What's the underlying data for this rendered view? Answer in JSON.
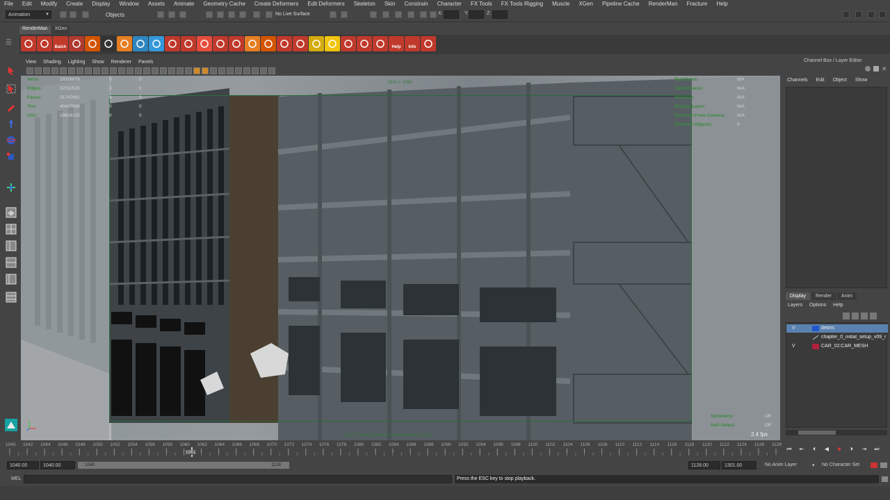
{
  "menubar": [
    "File",
    "Edit",
    "Modify",
    "Create",
    "Display",
    "Window",
    "Assets",
    "Animate",
    "Geometry Cache",
    "Create Deformers",
    "Edit Deformers",
    "Skeleton",
    "Skin",
    "Constrain",
    "Character",
    "FX Tools",
    "FX Tools Rigging",
    "Muscle",
    "XGen",
    "Pipeline Cache",
    "RenderMan",
    "Fracture",
    "Help"
  ],
  "status": {
    "mode": "Animation",
    "objects_label": "Objects",
    "no_live_surface": "No Live Surface",
    "x_label": "X:",
    "y_label": "Y:",
    "z_label": "Z:"
  },
  "shelf": {
    "tabs": [
      "RenderMan",
      "XGen"
    ],
    "icons": [
      {
        "name": "render-settings-icon",
        "label": "",
        "color": "#c0392b"
      },
      {
        "name": "render-preview-icon",
        "label": "",
        "color": "#c0392b"
      },
      {
        "name": "render-batch-icon",
        "label": "Batch",
        "color": "#c0392b"
      },
      {
        "name": "render-region-icon",
        "label": "",
        "color": "#b03a2e"
      },
      {
        "name": "globe-wire-icon",
        "label": "",
        "color": "#d35400"
      },
      {
        "name": "eye-icon",
        "label": "",
        "color": "#333333"
      },
      {
        "name": "light-bulb-icon",
        "label": "",
        "color": "#e67e22"
      },
      {
        "name": "env-sphere-icon",
        "label": "",
        "color": "#2e86c1"
      },
      {
        "name": "blue-sphere-icon",
        "label": "",
        "color": "#3498db"
      },
      {
        "name": "shader-list-icon",
        "label": "",
        "color": "#c0392b"
      },
      {
        "name": "texture-icon",
        "label": "",
        "color": "#c0392b"
      },
      {
        "name": "pattern-icon",
        "label": "",
        "color": "#e74c3c"
      },
      {
        "name": "plane-light-icon",
        "label": "",
        "color": "#c0392b"
      },
      {
        "name": "brush-icon",
        "label": "",
        "color": "#c0392b"
      },
      {
        "name": "hand-icon",
        "label": "",
        "color": "#e67e22"
      },
      {
        "name": "globe-orange-icon",
        "label": "",
        "color": "#d35400"
      },
      {
        "name": "image-tool-icon",
        "label": "",
        "color": "#c0392b"
      },
      {
        "name": "search-doc-icon",
        "label": "",
        "color": "#c0392b"
      },
      {
        "name": "spotlight-icon",
        "label": "",
        "color": "#d4ac0d"
      },
      {
        "name": "yellow-sphere-icon",
        "label": "",
        "color": "#f1c40f"
      },
      {
        "name": "crosshair-icon",
        "label": "",
        "color": "#c0392b"
      },
      {
        "name": "curve-tool-icon",
        "label": "",
        "color": "#c0392b"
      },
      {
        "name": "graph-icon",
        "label": "",
        "color": "#c0392b"
      },
      {
        "name": "help-icon",
        "label": "Help",
        "color": "#c0392b"
      },
      {
        "name": "info-icon",
        "label": "Info",
        "color": "#c0392b"
      },
      {
        "name": "plugin-icon",
        "label": "",
        "color": "#c0392b"
      }
    ]
  },
  "panel": {
    "menu": [
      "View",
      "Shading",
      "Lighting",
      "Show",
      "Renderer",
      "Panels"
    ],
    "resolution": "1920 x 1080",
    "camera": "vn017_renderCamera (defaultRenderLayer)",
    "fps": "2.4 fps",
    "hud_left": [
      {
        "label": "Verts:",
        "value": "20326679",
        "a": "0",
        "b": "0"
      },
      {
        "label": "Edges:",
        "value": "52011529",
        "a": "0",
        "b": "0"
      },
      {
        "label": "Faces:",
        "value": "31747691",
        "a": "0",
        "b": "0"
      },
      {
        "label": "Tris:",
        "value": "40427939",
        "a": "0",
        "b": "0"
      },
      {
        "label": "UVs:",
        "value": "18626125",
        "a": "0",
        "b": "0"
      }
    ],
    "hud_right": [
      {
        "label": "Backfaces:",
        "value": "N/A"
      },
      {
        "label": "Smoothness:",
        "value": "N/A"
      },
      {
        "label": "Instance:",
        "value": "N/A"
      },
      {
        "label": "Display Layer:",
        "value": "N/A"
      },
      {
        "label": "Distance From Camera:",
        "value": "N/A"
      },
      {
        "label": "Selected Objects:",
        "value": "0"
      }
    ],
    "hud_bottom": [
      {
        "label": "Symmetry:",
        "value": "Off"
      },
      {
        "label": "Soft Select:",
        "value": "Off"
      }
    ]
  },
  "channel_box": {
    "title": "Channel Box / Layer Editor",
    "menu": [
      "Channels",
      "Edit",
      "Object",
      "Show"
    ]
  },
  "layer_editor": {
    "tabs": [
      "Display",
      "Render",
      "Anim"
    ],
    "menu": [
      "Layers",
      "Options",
      "Help"
    ],
    "layers": [
      {
        "v": "V",
        "name": "debris",
        "color": "#2255cc",
        "selected": true
      },
      {
        "v": "",
        "name": "chapter_0_initial_setup_v09_r",
        "color": "",
        "selected": false
      },
      {
        "v": "V",
        "name": "CAR_02:CAR_MESH",
        "color": "#b0203a",
        "selected": false
      }
    ]
  },
  "timeline": {
    "ticks": [
      "1040",
      "1042",
      "1044",
      "1046",
      "1048",
      "1050",
      "1052",
      "1054",
      "1056",
      "1058",
      "1060",
      "1062",
      "1064",
      "1066",
      "1068",
      "1070",
      "1072",
      "1074",
      "1076",
      "1078",
      "1080",
      "1082",
      "1084",
      "1086",
      "1088",
      "1090",
      "1092",
      "1094",
      "1096",
      "1098",
      "1100",
      "1102",
      "1104",
      "1106",
      "1108",
      "1110",
      "1112",
      "1114",
      "1116",
      "1118",
      "1120",
      "1122",
      "1124",
      "1126",
      "1128"
    ],
    "current": "1061"
  },
  "range": {
    "start": "1040.00",
    "playback_start": "1040.00",
    "bar_start": "1040",
    "bar_end": "1128",
    "playback_end": "1128.00",
    "end": "1301.00",
    "anim_layer": "No Anim Layer",
    "character_set": "No Character Set"
  },
  "cmd": {
    "mel": "MEL",
    "result": "Press the ESC key to stop playback."
  }
}
